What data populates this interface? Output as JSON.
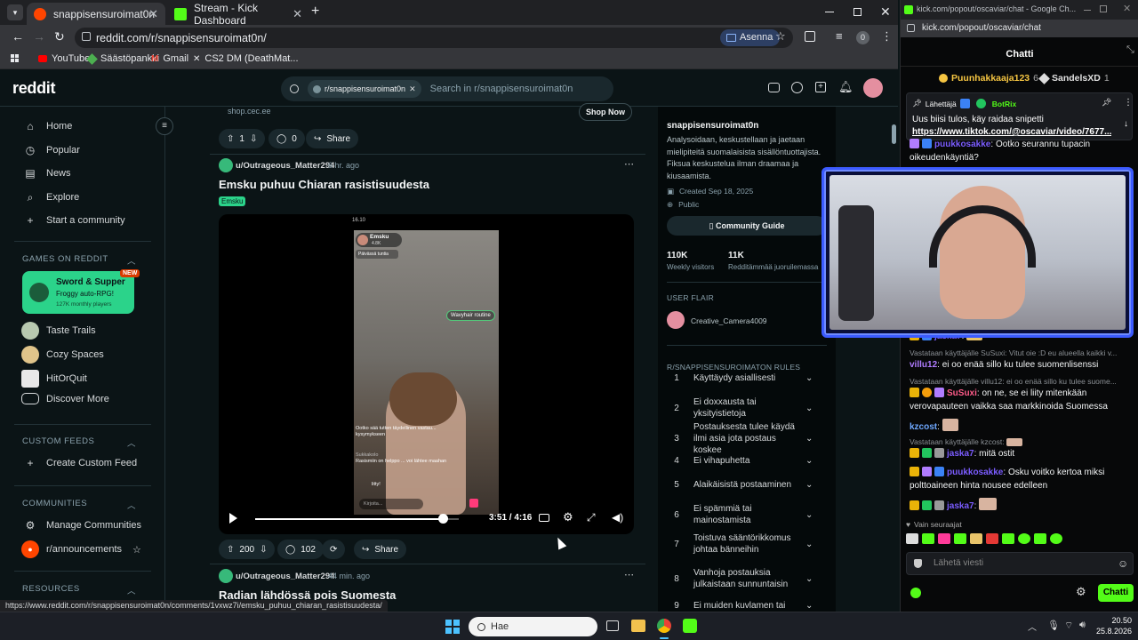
{
  "browser": {
    "tabs": [
      {
        "title": "snappisensuroimat0n",
        "active": true
      },
      {
        "title": "Stream - Kick Dashboard",
        "active": false
      }
    ],
    "new_tab": "+",
    "url": "reddit.com/r/snappisensuroimat0n/",
    "install_label": "Asenna",
    "profile_badge": "0",
    "bookmarks": [
      "YouTube",
      "Säästöpankki",
      "Gmail",
      "CS2 DM (DeathMat..."
    ],
    "status_url": "https://www.reddit.com/r/snappisensuroimat0n/comments/1vxwz7i/emsku_puhuu_chiaran_rasistisuudesta/"
  },
  "reddit": {
    "logo": "reddit",
    "search_chip": "r/snappisensuroimat0n",
    "search_placeholder": "Search in r/snappisensuroimat0n",
    "sidebar": {
      "nav": [
        "Home",
        "Popular",
        "News",
        "Explore",
        "Start a community"
      ],
      "games_header": "GAMES ON REDDIT",
      "featured_game": {
        "title": "Sword & Supper",
        "subtitle": "Froggy auto-RPG!",
        "players": "127K monthly players",
        "badge": "NEW"
      },
      "games": [
        "Taste Trails",
        "Cozy Spaces",
        "HitOrQuit",
        "Discover More"
      ],
      "custom_feeds_header": "CUSTOM FEEDS",
      "create_feed": "Create Custom Feed",
      "communities_header": "COMMUNITIES",
      "manage": "Manage Communities",
      "announcements": "r/announcements",
      "resources_header": "RESOURCES"
    },
    "ad": {
      "domain": "shop.cec.ee",
      "cta": "Shop Now",
      "votes": "1",
      "comments": "0",
      "share": "Share"
    },
    "post1": {
      "author": "u/Outrageous_Matter294",
      "time": "6 hr. ago",
      "title": "Emsku puhuu Chiaran rasistisuudesta",
      "flair": "Emsku",
      "video_time": "3:51 / 4:16",
      "progress": 0.92,
      "votes": "200",
      "comments": "102",
      "share": "Share",
      "phone": {
        "time": "16.10",
        "name": "Emsku",
        "followers": "4.8K",
        "subtag": "Päivässä tuntia",
        "tag": "Wavyhair routine",
        "comment1_user": "Ootko",
        "comment1": "Ootko sää tutten täydellinen vastau... kysymykseen",
        "comment2_user": "Sukkakolo",
        "comment2": "Rasismiin on helppo ... voi lähtee maahan",
        "comment3": "litty!",
        "input": "Kirjoita..."
      }
    },
    "post2": {
      "author": "u/Outrageous_Matter294",
      "time": "44 min. ago",
      "title": "Radian lähdössä pois Suomesta"
    },
    "right": {
      "name": "snappisensuroimat0n",
      "description": "Analysoidaan, keskustellaan ja jaetaan mielipiteitä suomalaisista sisällöntuottajista. Fiksua keskustelua ilman draamaa ja kiusaamista.",
      "created": "Created Sep 18, 2025",
      "visibility": "Public",
      "guide": "Community Guide",
      "stat1_value": "110K",
      "stat1_label": "Weekly visitors",
      "stat2_value": "11K",
      "stat2_label": "Redditämmää juoruilemassa",
      "flair_header": "USER FLAIR",
      "flair_user": "Creative_Camera4009",
      "rules_header": "R/SNAPPISENSUROIMATON RULES",
      "rules": [
        {
          "n": "1",
          "text": "Käyttäydy asiallisesti"
        },
        {
          "n": "2",
          "text": "Ei doxxausta tai yksityistietoja"
        },
        {
          "n": "3",
          "text": "Postauksesta tulee käydä ilmi asia jota postaus koskee"
        },
        {
          "n": "4",
          "text": "Ei vihapuhetta"
        },
        {
          "n": "5",
          "text": "Alaikäisistä postaaminen"
        },
        {
          "n": "6",
          "text": "Ei spämmiä tai mainostamista"
        },
        {
          "n": "7",
          "text": "Toistuva sääntörikkomus johtaa bänneihin"
        },
        {
          "n": "8",
          "text": "Vanhoja postauksia julkaistaan sunnuntaisin"
        },
        {
          "n": "9",
          "text": "Ei muiden kuvlamen tai"
        }
      ]
    }
  },
  "kick": {
    "window_url": "kick.com/popout/oscaviar/chat - Google Ch...",
    "address": "kick.com/popout/oscaviar/chat",
    "tab_title": "Chatti",
    "top_gifters": [
      {
        "name": "Puunhakkaaja123",
        "count": "6"
      },
      {
        "name": "SandelsXD",
        "count": "1"
      }
    ],
    "pinned": {
      "label": "Lähettäjä",
      "by": "BotRix",
      "text": "Uus biisi tulos, käy raidaa snipetti",
      "link": "https://www.tiktok.com/@oscaviar/video/7677..."
    },
    "messages": [
      {
        "user": "puukkosakke",
        "color": "#7b5cff",
        "text": "Ootko seurannu tupacin oikeudenkäyntiä?"
      },
      {
        "user": "jaska7",
        "color": "#7b5cff",
        "text": ""
      },
      {
        "reply": "Vastataan käyttäjälle SuSuxi: Vitut oie :D eu alueella kaikki v..."
      },
      {
        "user": "villu12",
        "color": "#b07cff",
        "text": "ei oo enää sillo ku tulee suomenlisenssi"
      },
      {
        "reply": "Vastataan käyttäjälle villu12: ei oo enää sillo ku tulee suome..."
      },
      {
        "user": "SuSuxi",
        "color": "#ff5c8a",
        "text": "on ne, se ei liity mitenkään verovapauteen vaikka saa markkinoida Suomessa"
      },
      {
        "user": "kzcost",
        "color": "#6ea8ff",
        "text": ""
      },
      {
        "reply": "Vastataan käyttäjälle kzcost:"
      },
      {
        "user": "jaska7",
        "color": "#7b5cff",
        "text": "mitä ostit"
      },
      {
        "user": "puukkosakke",
        "color": "#7b5cff",
        "text": "Osku voitko kertoa miksi polttoaineen hinta nousee edelleen"
      },
      {
        "user": "jaska7",
        "color": "#7b5cff",
        "text": ""
      }
    ],
    "followers_only": "Vain seuraajat",
    "input_placeholder": "Lähetä viesti",
    "send_label": "Chatti"
  },
  "taskbar": {
    "search": "Hae",
    "time": "20.50",
    "date": "25.8.2026"
  }
}
